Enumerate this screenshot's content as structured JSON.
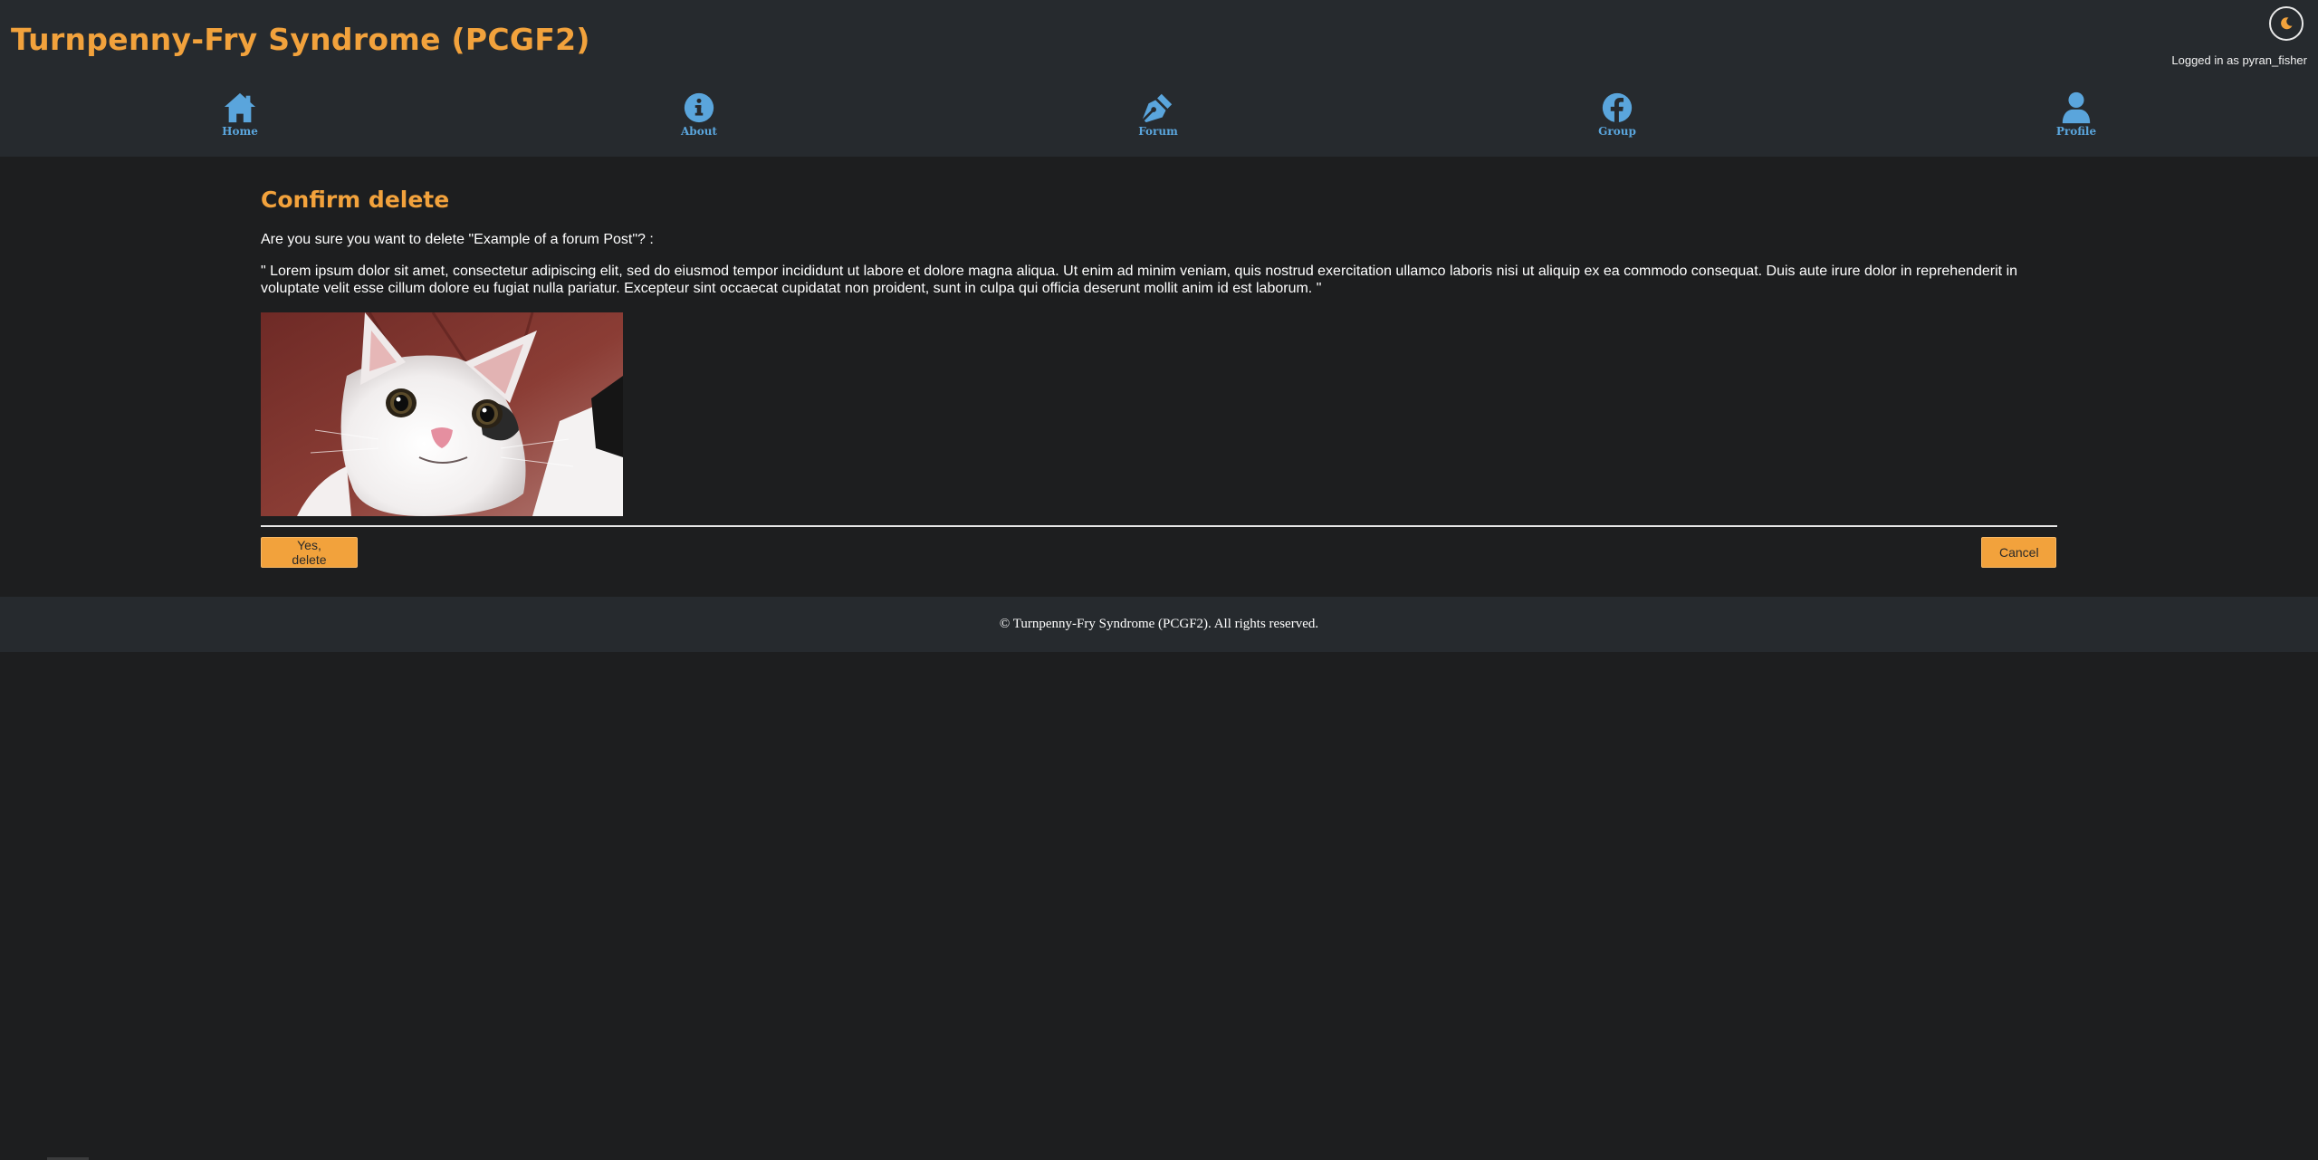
{
  "header": {
    "site_title": "Turnpenny-Fry Syndrome (PCGF2)",
    "login_status": "Logged in as pyran_fisher",
    "theme_toggle_icon": "moon-icon"
  },
  "nav": {
    "items": [
      {
        "label": "Home",
        "icon": "home-icon"
      },
      {
        "label": "About",
        "icon": "info-icon"
      },
      {
        "label": "Forum",
        "icon": "pen-nib-icon"
      },
      {
        "label": "Group",
        "icon": "facebook-icon"
      },
      {
        "label": "Profile",
        "icon": "user-icon"
      }
    ]
  },
  "confirm": {
    "heading": "Confirm delete",
    "question": "Are you sure you want to delete \"Example of a forum Post\"? :",
    "post_body": "\" Lorem ipsum dolor sit amet, consectetur adipiscing elit, sed do eiusmod tempor incididunt ut labore et dolore magna aliqua. Ut enim ad minim veniam, quis nostrud exercitation ullamco laboris nisi ut aliquip ex ea commodo consequat. Duis aute irure dolor in reprehenderit in voluptate velit esse cillum dolore eu fugiat nulla pariatur. Excepteur sint occaecat cupidatat non proident, sunt in culpa qui officia deserunt mollit anim id est laborum. \"",
    "yes_label": "Yes, delete",
    "cancel_label": "Cancel"
  },
  "footer": {
    "text": "© Turnpenny-Fry Syndrome (PCGF2). All rights reserved."
  },
  "colors": {
    "accent": "#f2a23c",
    "nav_blue": "#5aa5dc",
    "header_bg": "#262a2e",
    "page_bg": "#1d1e1f"
  }
}
